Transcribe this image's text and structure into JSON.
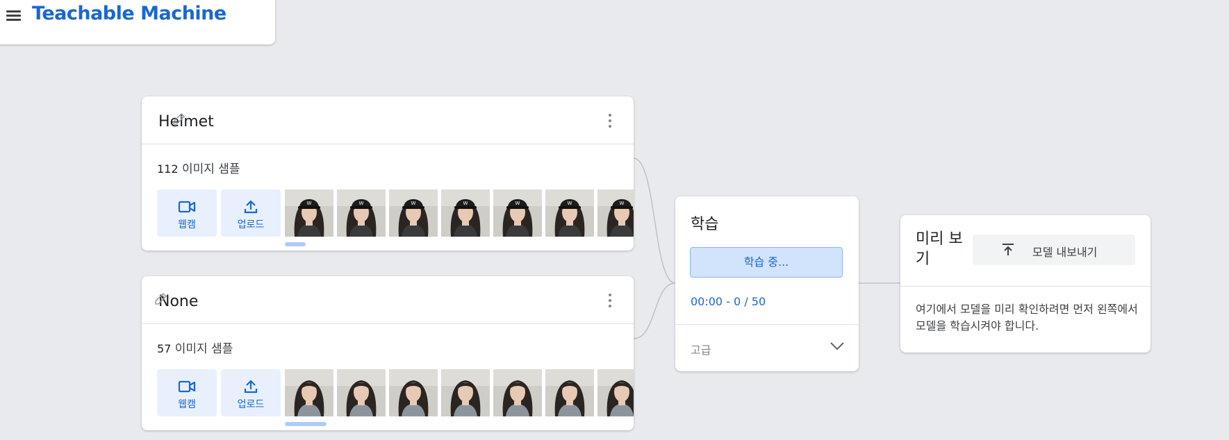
{
  "app": {
    "title": "Teachable Machine"
  },
  "classes": [
    {
      "name": "Helmet",
      "sample_count": "112",
      "sample_label": "이미지 샘플",
      "webcam_label": "웹캠",
      "upload_label": "업로드",
      "thumbnail_count": 7,
      "thumbnail_subject": "person-wearing-black-cap"
    },
    {
      "name": "None",
      "sample_count": "57",
      "sample_label": "이미지 샘플",
      "webcam_label": "웹캠",
      "upload_label": "업로드",
      "thumbnail_count": 7,
      "thumbnail_subject": "person-without-cap"
    }
  ],
  "training": {
    "title": "학습",
    "button_label": "학습 중...",
    "timer": "00:00 - 0 / 50",
    "advanced_label": "고급"
  },
  "preview": {
    "title": "미리 보기",
    "export_label": "모델 내보내기",
    "message": "여기에서 모델을 미리 확인하려면 먼저 왼쪽에서 모델을 학습시켜야 합니다."
  },
  "colors": {
    "accent": "#1967d2",
    "background": "#e8eaed",
    "button_fill": "#e8f0fe",
    "train_button_fill": "#d2e3fc",
    "divider": "#e0e0e0"
  }
}
